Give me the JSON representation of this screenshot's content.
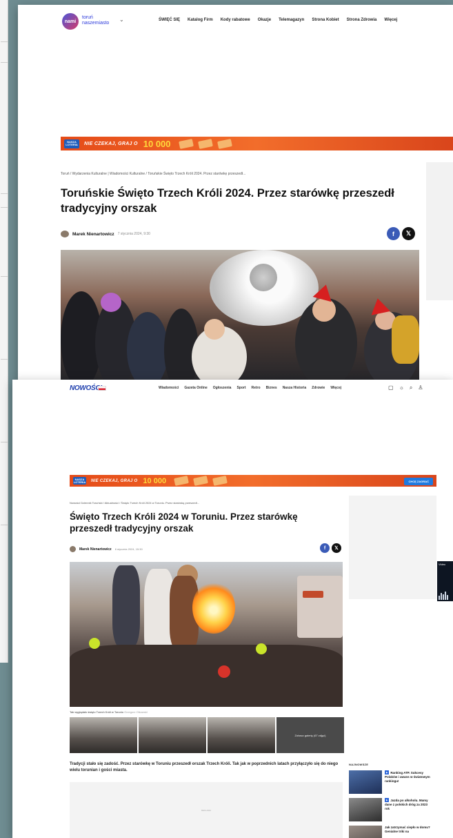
{
  "screen1": {
    "logo": {
      "badge": "nami",
      "line1": "toruń",
      "line2": "naszemiasto"
    },
    "nav": [
      "ŚWIĘĆ SIĘ",
      "Katalog Firm",
      "Kody rabatowe",
      "Okazje",
      "Telemagazyn",
      "Strona Kobiet",
      "Strona Zdrowia",
      "Więcej"
    ],
    "ad": {
      "badge": "NASZA LOTERIA",
      "text": "NIE CZEKAJ, GRAJ O",
      "amount": "10 000"
    },
    "breadcrumb": "Toruń / Wydarzenia Kulturalne | Wiadomości Kulturalne / Toruńskie Święto Trzech Króli 2024. Przez starówkę przeszedł...",
    "title": "Toruńskie Święto Trzech Króli 2024. Przez starówkę przeszedł tradycyjny orszak",
    "author": "Marek Nienartowicz",
    "date": "7 stycznia 2024, 9:30"
  },
  "screen2": {
    "logo": "NOWOŚCI",
    "nav": [
      "Wiadomości",
      "Gazeta Online",
      "Ogłoszenia",
      "Sport",
      "Retro",
      "Biznes",
      "Nasza Historia",
      "Zdrowie",
      "Więcej"
    ],
    "ad": {
      "badge": "NASZA LOTERIA",
      "text": "NIE CZEKAJ, GRAJ O",
      "amount": "10 000",
      "cta": "CHCĘ ZAGRAĆ"
    },
    "breadcrumb": "Nowości Dziennik Toruński / Aktualności / Święto Trzech Króli 2024 w Toruniu. Przez starówkę przeszedł...",
    "title": "Święto Trzech Króli 2024 w Toruniu. Przez starówkę przeszedł tradycyjny orszak",
    "author": "Marek Nienartowicz",
    "date": "6 stycznia 2024, 15:30",
    "caption": "Tak wyglądało święto Trzech Króli w Toruniu",
    "caption_credit": "Grzegorz Olkowski",
    "gallery_more": "Zobacz galerię (67 zdjęć)",
    "lead": "Tradycji stało się zadość. Przez starówkę w Toruniu przeszedł orszak Trzech Króli. Tak jak w poprzednich latach przyłączyło się do niego wielu torunian i gości miasta.",
    "ad_label": "REKLAMA",
    "latest": {
      "heading": "NAJNOWSZE",
      "items": [
        {
          "text": "Ranking ATP. Sukcesy Polaków i awans w światowym rankingu!"
        },
        {
          "text": "Jazda po alkoholu. Mamy dane z polskich dróg za 2023 rok"
        },
        {
          "text": "Jak zatrzymać ciepło w domu? Genialne triki na"
        }
      ]
    },
    "video_label": "Video"
  }
}
